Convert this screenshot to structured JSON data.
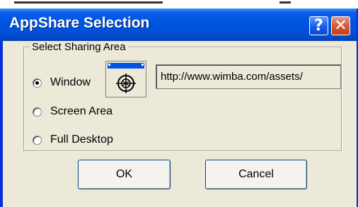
{
  "window": {
    "title": "AppShare Selection",
    "help_glyph": "?",
    "close_glyph": "✕"
  },
  "group": {
    "legend": "Select Sharing Area",
    "options": [
      {
        "label": "Window",
        "checked": true
      },
      {
        "label": "Screen Area",
        "checked": false
      },
      {
        "label": "Full Desktop",
        "checked": false
      }
    ],
    "window_icon": "crosshair-target-icon",
    "url_value": "http://www.wimba.com/assets/"
  },
  "buttons": {
    "ok_label": "OK",
    "cancel_label": "Cancel"
  },
  "colors": {
    "titlebar_blue": "#0054e3",
    "dialog_face": "#ece9d8",
    "close_red": "#d2552f"
  }
}
